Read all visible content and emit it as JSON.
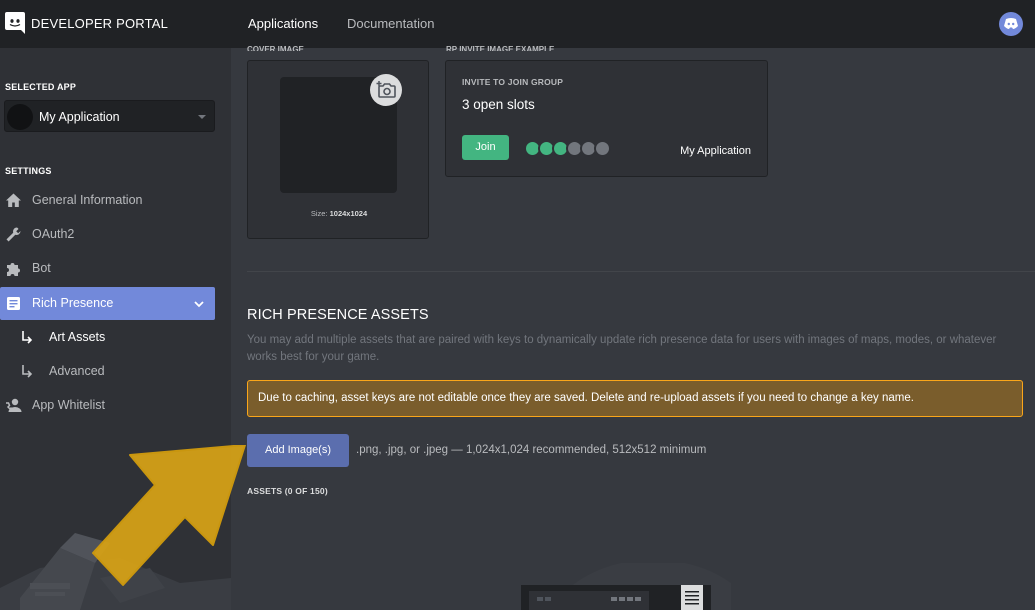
{
  "topbar": {
    "brand": "DEVELOPER PORTAL",
    "tabs": [
      "Applications",
      "Documentation"
    ]
  },
  "sidebar": {
    "selected_app_label": "SELECTED APP",
    "app_name": "My Application",
    "settings_label": "SETTINGS",
    "items": [
      {
        "label": "General Information",
        "icon": "home-icon"
      },
      {
        "label": "OAuth2",
        "icon": "wrench-icon"
      },
      {
        "label": "Bot",
        "icon": "puzzle-icon"
      },
      {
        "label": "Rich Presence",
        "icon": "document-icon",
        "active": true
      },
      {
        "label": "App Whitelist",
        "icon": "person-icon"
      }
    ],
    "sub_items": [
      {
        "label": "Art Assets",
        "active": true
      },
      {
        "label": "Advanced"
      }
    ]
  },
  "cover": {
    "section_label": "COVER IMAGE",
    "size_prefix": "Size: ",
    "size_value": "1024x1024"
  },
  "invite": {
    "section_label": "RP INVITE IMAGE EXAMPLE",
    "header": "INVITE TO JOIN GROUP",
    "slots": "3 open slots",
    "join_label": "Join",
    "app_name": "My Application"
  },
  "assets": {
    "title": "RICH PRESENCE ASSETS",
    "description": "You may add multiple assets that are paired with keys to dynamically update rich presence data for users with images of maps, modes, or whatever works best for your game.",
    "warning": "Due to caching, asset keys are not editable once they are saved. Delete and re-upload assets if you need to change a key name.",
    "add_button": "Add Image(s)",
    "add_hint": ".png, .jpg, or .jpeg — 1,024x1,024 recommended, 512x512 minimum",
    "count": "ASSETS (0 OF 150)"
  },
  "colors": {
    "accent": "#7289da",
    "join": "#43b581",
    "warning_bg": "#7a5d2c",
    "warning_border": "#faa61a",
    "arrow": "#d4a017"
  }
}
